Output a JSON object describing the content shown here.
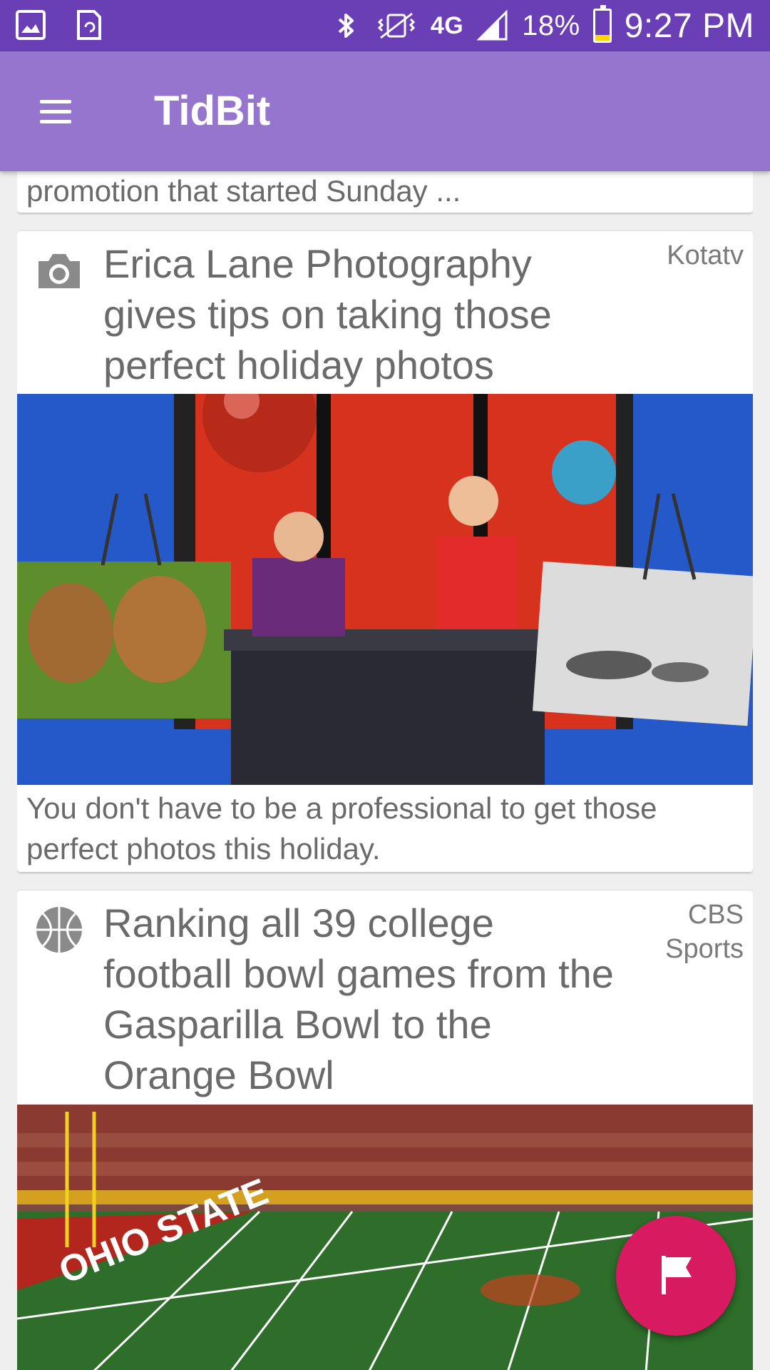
{
  "status_bar": {
    "battery_percent": "18%",
    "battery_level": 0.18,
    "time": "9:27 PM",
    "network": "4G",
    "icons": [
      "gallery-icon",
      "screenshot-icon",
      "bluetooth-icon",
      "vibrate-icon",
      "signal-icon",
      "battery-icon"
    ]
  },
  "app_bar": {
    "title": "TidBit",
    "menu_icon": "hamburger-menu-icon",
    "color": "#9575cd"
  },
  "feed": {
    "previous_card": {
      "summary": "promotion that started Sunday ..."
    },
    "cards": [
      {
        "category_icon": "camera-icon",
        "headline": "Erica Lane Photography gives tips on taking those perfect holiday photos",
        "source": "Kotatv",
        "image": "tv-studio-holiday-set-photo",
        "summary": "You don't have to be a professional to get those perfect photos this holiday."
      },
      {
        "category_icon": "sports-ball-icon",
        "headline": "Ranking all 39 college football bowl games from the Gasparilla Bowl to the Orange Bowl",
        "source": "CBS Sports",
        "image": "football-stadium-photo",
        "field_text": "OHIO STATE"
      }
    ]
  },
  "fab": {
    "icon": "flag-icon",
    "color": "#d81b60"
  }
}
